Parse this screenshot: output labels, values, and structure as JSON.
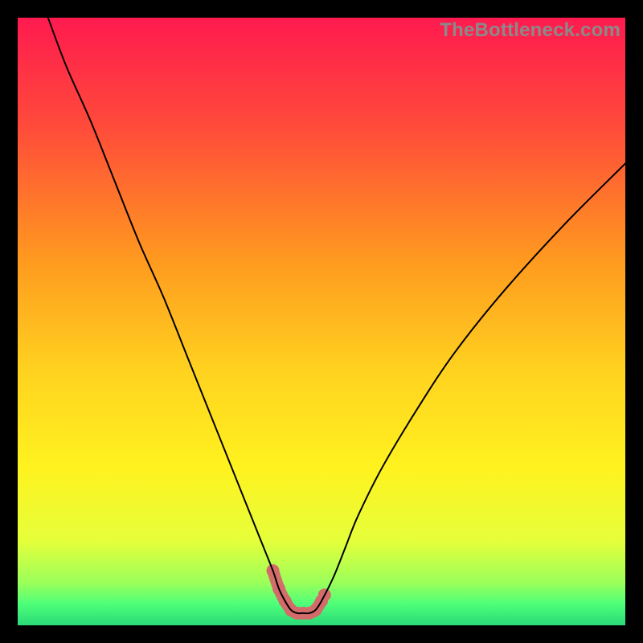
{
  "watermark": "TheBottleneck.com",
  "colors": {
    "frame": "#000000",
    "curve": "#000000",
    "highlight": "#d46a6a",
    "gradient_stops": [
      {
        "offset": 0.0,
        "color": "#ff1a4f"
      },
      {
        "offset": 0.18,
        "color": "#ff4b3a"
      },
      {
        "offset": 0.4,
        "color": "#ff9a1f"
      },
      {
        "offset": 0.58,
        "color": "#ffd21f"
      },
      {
        "offset": 0.74,
        "color": "#fff21f"
      },
      {
        "offset": 0.86,
        "color": "#e6ff3a"
      },
      {
        "offset": 0.93,
        "color": "#9bff5a"
      },
      {
        "offset": 0.965,
        "color": "#4dff78"
      },
      {
        "offset": 1.0,
        "color": "#2bd978"
      }
    ]
  },
  "chart_data": {
    "type": "line",
    "title": "",
    "xlabel": "",
    "ylabel": "",
    "xlim": [
      0,
      100
    ],
    "ylim": [
      0,
      100
    ],
    "series": [
      {
        "name": "bottleneck-curve",
        "x": [
          5,
          8,
          12,
          16,
          20,
          24,
          28,
          32,
          34,
          36,
          38,
          40,
          42,
          43,
          44,
          45,
          46,
          47,
          48,
          49,
          50,
          52,
          54,
          56,
          60,
          66,
          72,
          80,
          90,
          100
        ],
        "y": [
          100,
          92,
          83,
          73,
          63,
          54,
          44,
          34,
          29,
          24,
          19,
          14,
          9,
          6,
          4,
          2.5,
          2,
          2,
          2,
          2.5,
          4,
          8,
          13,
          18,
          26,
          36,
          45,
          55,
          66,
          76
        ]
      }
    ],
    "highlight_region": {
      "x_start": 41.5,
      "x_end": 51,
      "y_max": 12
    },
    "highlight_markers_x": [
      42,
      43,
      44,
      45,
      46,
      47,
      48,
      49,
      50,
      50.5
    ]
  }
}
